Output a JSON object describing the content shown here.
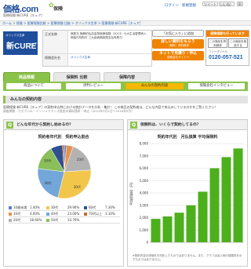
{
  "header": {
    "logo_main": "価格.com",
    "logo_sub": "保険",
    "tagline": "医療保険 新CURE［キュア］",
    "links": [
      "ログイン",
      "新規登録"
    ],
    "social": [
      "ツイート",
      "いいね！",
      "B!"
    ]
  },
  "breadcrumb": "ホーム > 保険 > 医療保険比較 > 医療保険 比較 > オリックス生命 > 医療保険 新CURE［キュア］",
  "product": {
    "logo_small": "オリックス生命",
    "logo_big": "新CURE",
    "logo_kana": "キュア",
    "rows": [
      {
        "head": "正式名称",
        "value": "無配当 無解約払戻金型医療保険（2013）七大生活習慣病入院給付特則付 三大疾病無制限支払特則付"
      },
      {
        "head": "保険会社名",
        "value": "オリックス生命",
        "link": true
      }
    ]
  },
  "actions": {
    "prompt": "「お気に入り」に追加",
    "btn1": "詳しい資料をもらう",
    "btn1_sub": "（無料）資料請求",
    "btn2": "ネットで見積り・申込",
    "btn2_sub": "保険会社サイトへ"
  },
  "consult": {
    "head": "保険相談も行っています",
    "b1": "この商品を資料請求",
    "b2": "この商品を相談する",
    "free": "フリーダイヤル",
    "phone": "0120-057-521"
  },
  "tabs": [
    "商品情報",
    "保険料 比較",
    "保障内容"
  ],
  "subnav": [
    "商品について",
    "評判レビュー",
    "みんなの契約内容",
    "保険会社インタビュー"
  ],
  "section": {
    "title": "みんなの契約内容",
    "desc": "医療保険 新CURE［キュア］の契約申込時における統計データを分析・集計！ この商品の契約者は、どんな内容で申込みしているのかをご覧ください！",
    "note": "調査期間：カカクコム・インシュアランス経由の資料請求・申込（2013年5月1日〜2016年5月）"
  },
  "q1": {
    "badge": "Q",
    "text": "どんな年代から契約し始めるの？"
  },
  "q2": {
    "badge": "Q",
    "text": "保険料は、いくらで契約してるの？"
  },
  "chart_data": [
    {
      "type": "pie",
      "title": "契約者年代別　契約申込割合",
      "categories": [
        "10歳未満",
        "10代",
        "20代",
        "30代",
        "40代",
        "50代",
        "60代",
        "70代以上"
      ],
      "values": [
        1.4,
        4.0,
        18.6,
        29.9,
        23.0,
        14.7,
        7.3,
        1.1
      ],
      "labels_text": [
        "1.40%",
        "4.00%",
        "18.60%",
        "29.90%",
        "23.00%",
        "14.70%",
        "7.30%",
        "1.10%"
      ],
      "colors": [
        "#5b7fc7",
        "#e8904a",
        "#b3b3b3",
        "#f2c64b",
        "#73a6d9",
        "#8bbf5a",
        "#2f4f8f",
        "#c96b2b"
      ],
      "slice_labels": [
        "20代",
        "30代",
        "40代",
        "50代"
      ]
    },
    {
      "type": "bar",
      "title": "契約年代別　月払換算 平均保険料",
      "categories": [
        "10歳未満",
        "10代",
        "20代",
        "30代",
        "40代",
        "50代",
        "60代",
        "70代以上"
      ],
      "values": [
        1900,
        2100,
        2400,
        3000,
        4100,
        6000,
        6900,
        7600
      ],
      "ylabel": "平均保険料（円）",
      "ylim": [
        0,
        8000
      ],
      "yticks": [
        "0",
        "1,000",
        "2,000",
        "3,000",
        "4,000",
        "5,000",
        "6,000",
        "7,000",
        "8,000"
      ],
      "color": "#4caf1c",
      "note": "※契約内容の詳細を平均化したものではありません。また、グラフは加入時の保険料を示すものではありません。"
    }
  ]
}
